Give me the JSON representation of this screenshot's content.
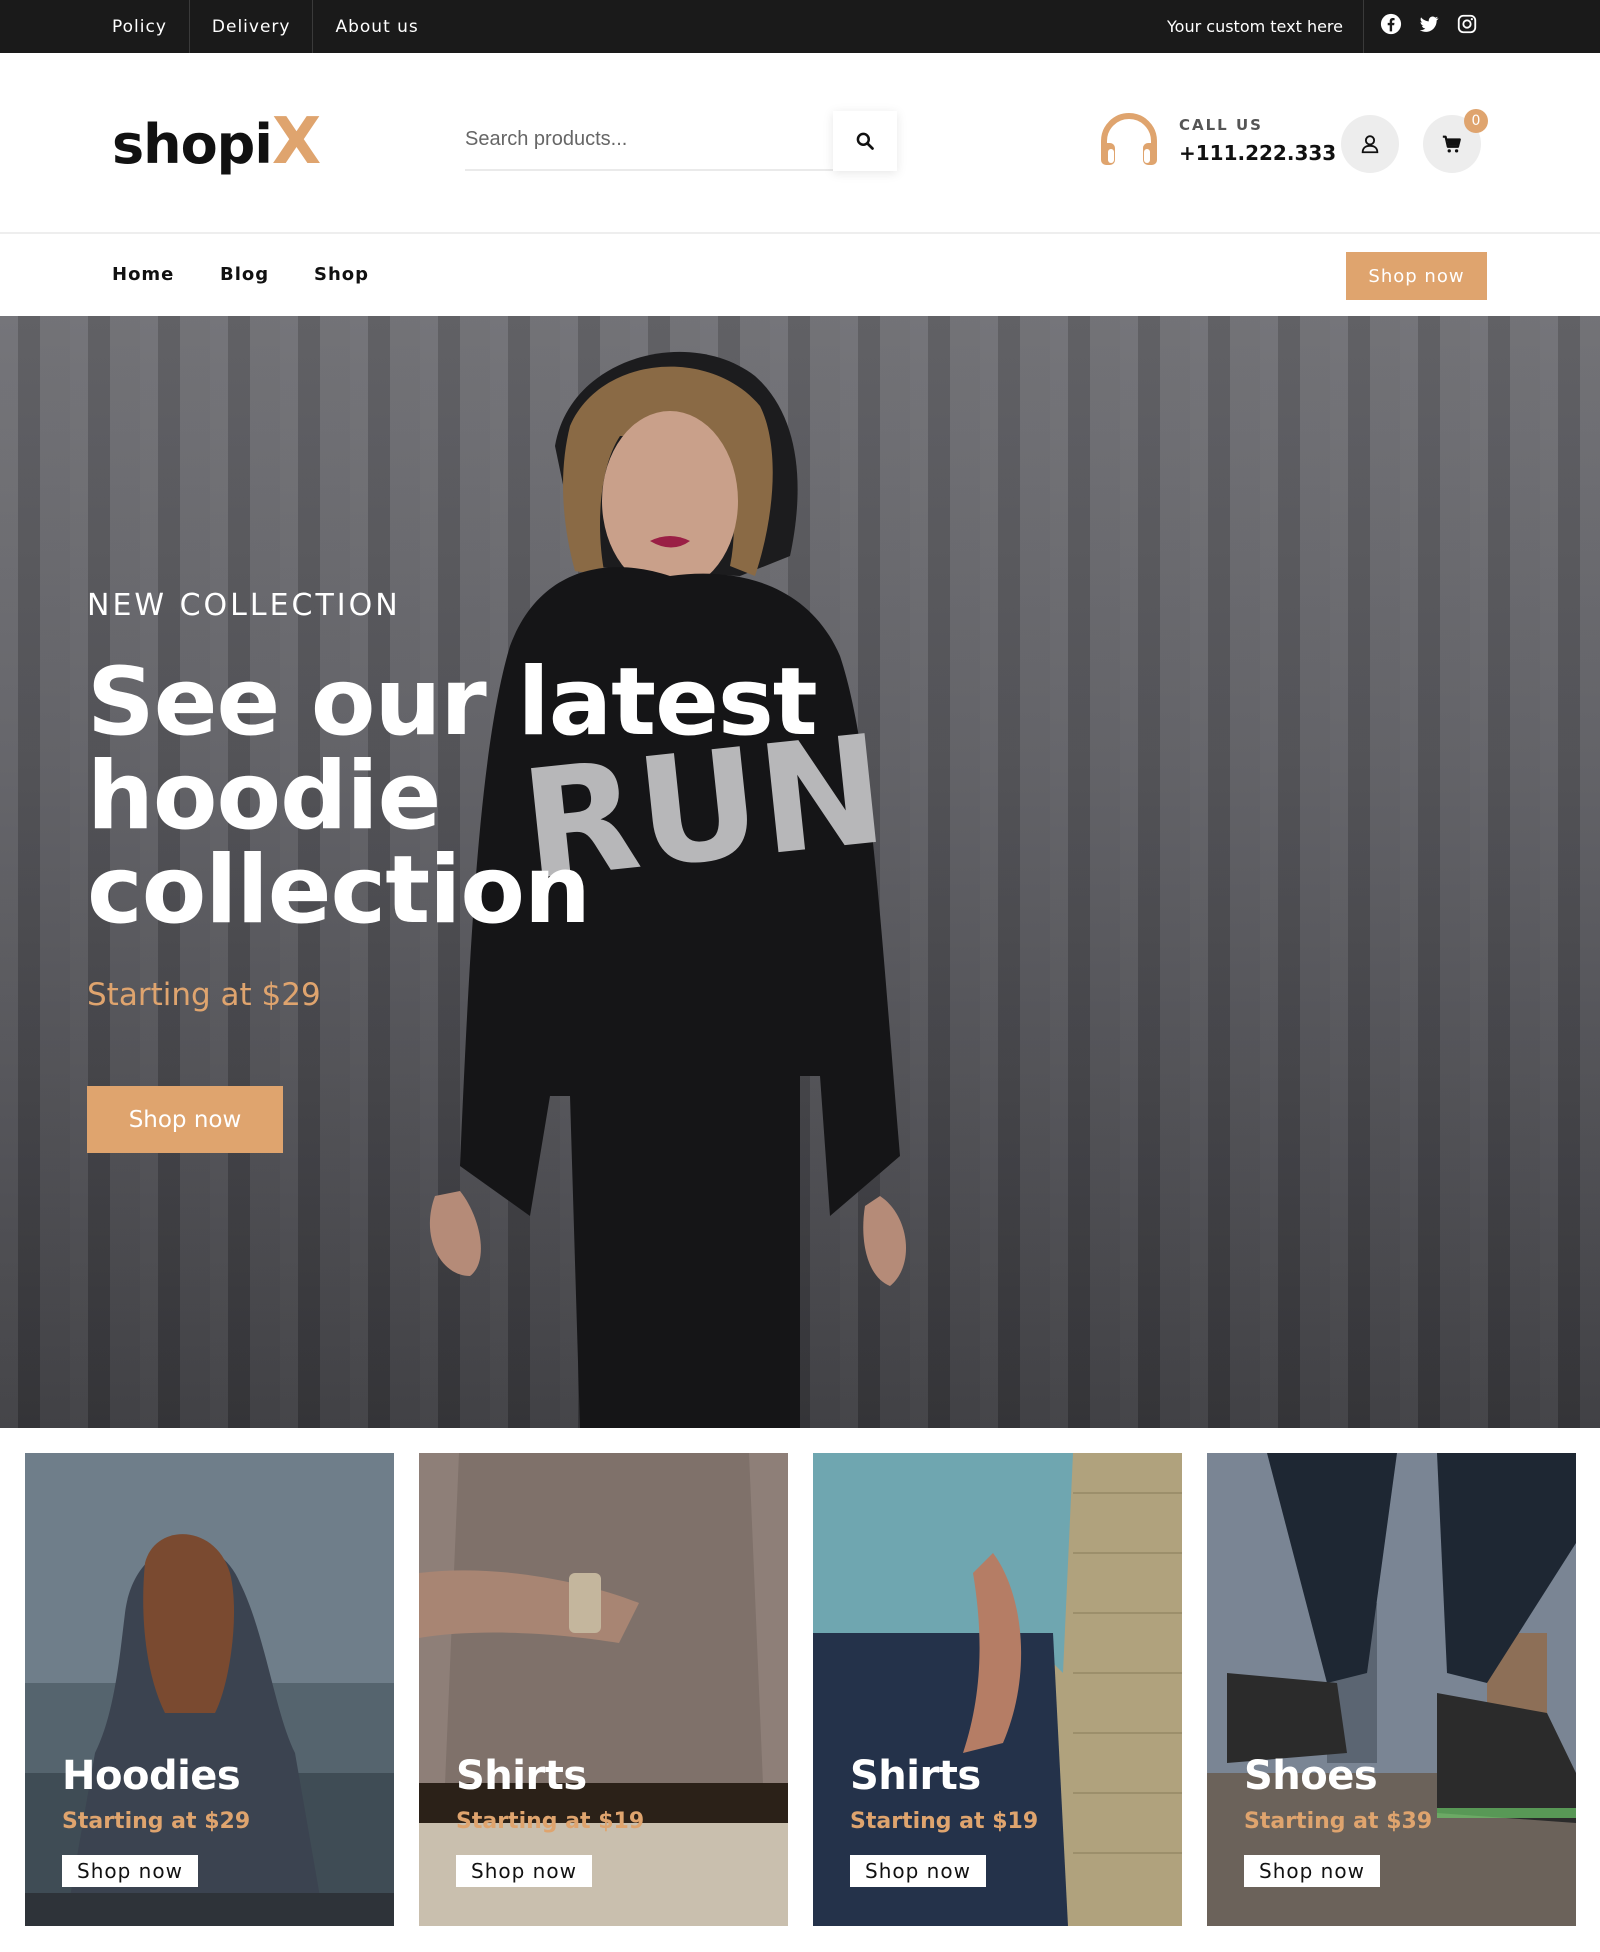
{
  "topbar": {
    "links": [
      "Policy",
      "Delivery",
      "About us"
    ],
    "custom_text": "Your custom text here",
    "social_icons": [
      "facebook-icon",
      "twitter-icon",
      "instagram-icon"
    ]
  },
  "header": {
    "logo_main": "shopi",
    "logo_accent": "X",
    "search_placeholder": "Search products...",
    "call_label": "CALL US",
    "call_number": "+111.222.333",
    "cart_count": "0"
  },
  "nav": {
    "items": [
      "Home",
      "Blog",
      "Shop"
    ],
    "cta": "Shop now"
  },
  "hero": {
    "eyebrow": "NEW COLLECTION",
    "title_lines": [
      "See our latest",
      "hoodie",
      "collection"
    ],
    "price": "Starting at $29",
    "cta": "Shop now"
  },
  "categories": [
    {
      "name": "Hoodies",
      "price": "Starting at $29",
      "cta": "Shop now"
    },
    {
      "name": "Shirts",
      "price": "Starting at $19",
      "cta": "Shop now"
    },
    {
      "name": "Shirts",
      "price": "Starting at $19",
      "cta": "Shop now"
    },
    {
      "name": "Shoes",
      "price": "Starting at $39",
      "cta": "Shop now"
    }
  ],
  "colors": {
    "accent": "#dfa46e",
    "topbar_bg": "#1a1a1a",
    "text_dark": "#111111"
  }
}
